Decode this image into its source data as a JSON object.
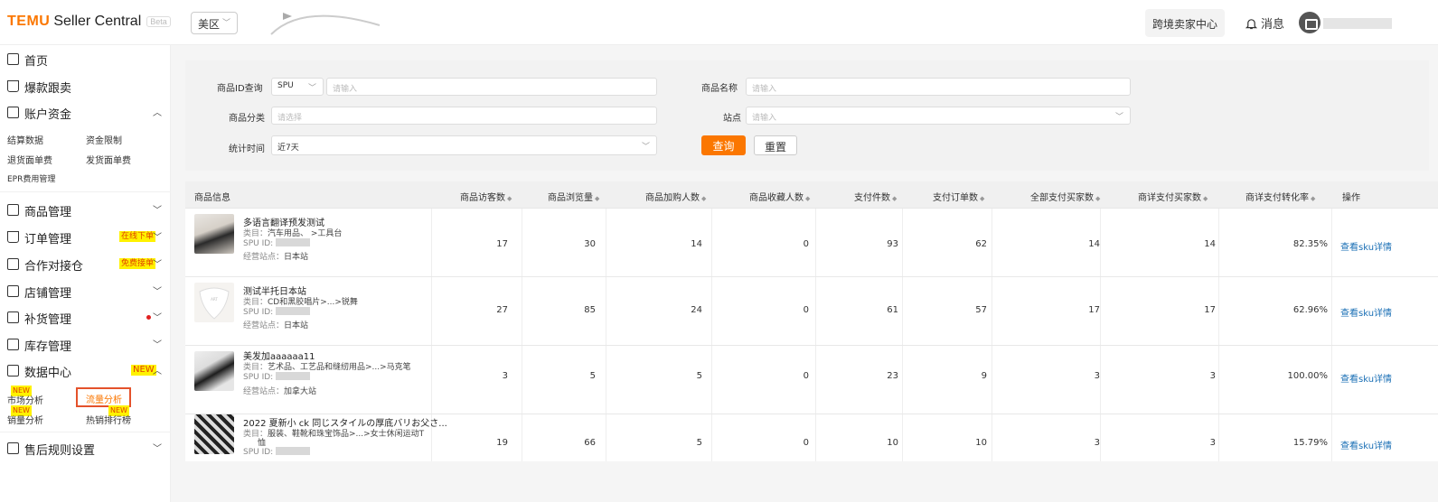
{
  "header": {
    "logo_brand": "TEMU",
    "logo_product": "Seller Central",
    "logo_badge": "Beta",
    "region_select": "美区",
    "cross_border_button": "跨境卖家中心",
    "messages_label": "消息"
  },
  "sidebar": {
    "home": "首页",
    "hot_sale": "爆款跟卖",
    "account_funds": "账户资金",
    "account_sub": [
      "结算数据",
      "资金限制",
      "退货面单费",
      "发货面单费",
      "EPR费用管理"
    ],
    "product_mgmt": "商品管理",
    "order_mgmt": "订单管理",
    "order_badge": "在线下单",
    "coop_dock": "合作对接仓",
    "coop_badge": "免费接单",
    "store_mgmt": "店铺管理",
    "restock_mgmt": "补货管理",
    "inventory_mgmt": "库存管理",
    "data_center": "数据中心",
    "data_center_badge": "NEW",
    "data_sub": [
      "市场分析",
      "流量分析",
      "销量分析",
      "热销排行榜"
    ],
    "new_tag": "NEW",
    "after_sale": "售后规则设置"
  },
  "filters": {
    "product_id_label": "商品ID查询",
    "product_id_type": "SPU",
    "product_id_placeholder": "请输入",
    "product_name_label": "商品名称",
    "product_name_placeholder": "请输入",
    "category_label": "商品分类",
    "category_placeholder": "请选择",
    "site_label": "站点",
    "site_placeholder": "请输入",
    "period_label": "统计时间",
    "period_value": "近7天",
    "query_button": "查询",
    "reset_button": "重置"
  },
  "table": {
    "columns": [
      "商品信息",
      "商品访客数",
      "商品浏览量",
      "商品加购人数",
      "商品收藏人数",
      "支付件数",
      "支付订单数",
      "全部支付买家数",
      "商详支付买家数",
      "商详支付转化率",
      "操作"
    ],
    "category_prefix": "类目：",
    "spu_prefix": "SPU ID:",
    "site_prefix": "经营站点：",
    "action_label": "查看sku详情",
    "rows": [
      {
        "name": "多语言翻译预发测试",
        "category": "汽车用品、 >工具台",
        "site": "日本站",
        "visitors": "17",
        "views": "30",
        "cart": "14",
        "fav": "0",
        "pay_items": "93",
        "pay_orders": "62",
        "all_buyers": "14",
        "detail_buyers": "14",
        "conv": "82.35%"
      },
      {
        "name": "测试半托日本站",
        "category": "CD和黑胶唱片>...>锐舞",
        "site": "日本站",
        "visitors": "27",
        "views": "85",
        "cart": "24",
        "fav": "0",
        "pay_items": "61",
        "pay_orders": "57",
        "all_buyers": "17",
        "detail_buyers": "17",
        "conv": "62.96%"
      },
      {
        "name": "美发加aaaaaa11",
        "category": "艺术品、工艺品和缝纫用品>...>马克笔",
        "site": "加拿大站",
        "visitors": "3",
        "views": "5",
        "cart": "5",
        "fav": "0",
        "pay_items": "23",
        "pay_orders": "9",
        "all_buyers": "3",
        "detail_buyers": "3",
        "conv": "100.00%"
      },
      {
        "name": "2022 夏新小 ck 同じスタイルの厚底バリお父さ...",
        "category": "服装、鞋靴和珠宝饰品>...>女士休闲运动T",
        "category_line2": "恤",
        "site": "",
        "visitors": "19",
        "views": "66",
        "cart": "5",
        "fav": "0",
        "pay_items": "10",
        "pay_orders": "10",
        "all_buyers": "3",
        "detail_buyers": "3",
        "conv": "15.79%"
      }
    ]
  },
  "colors": {
    "brand_orange": "#fb7701",
    "link_blue": "#1a6fb5",
    "highlight_red": "#e4522b",
    "badge_yellow": "#fff200"
  }
}
